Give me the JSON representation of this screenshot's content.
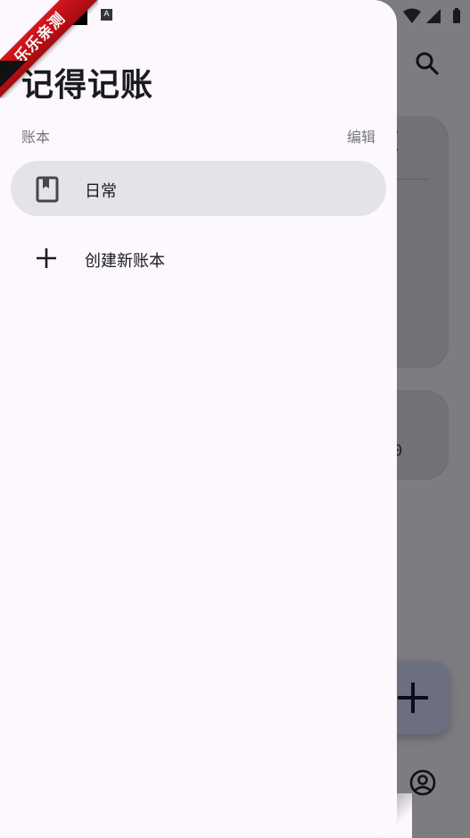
{
  "watermark": {
    "text": "乐乐亲测"
  },
  "status_bar": {
    "badge": "A"
  },
  "drawer": {
    "title": "记得记账",
    "section_label": "账本",
    "edit_label": "编辑",
    "books": [
      {
        "label": "日常",
        "icon": "book-icon",
        "selected": true
      }
    ],
    "create_label": "创建新账本",
    "create_icon": "plus-icon"
  },
  "background_app": {
    "card_value_fragment": "0",
    "search_icon": "search-icon",
    "fab_icon": "plus-icon",
    "profile_icon": "account-circle-icon"
  },
  "colors": {
    "drawer_bg": "#fcf8fd",
    "selected_item_bg": "#e3e3e8",
    "scrim": "#7d7c80",
    "ribbon_red": "#d6161c"
  }
}
